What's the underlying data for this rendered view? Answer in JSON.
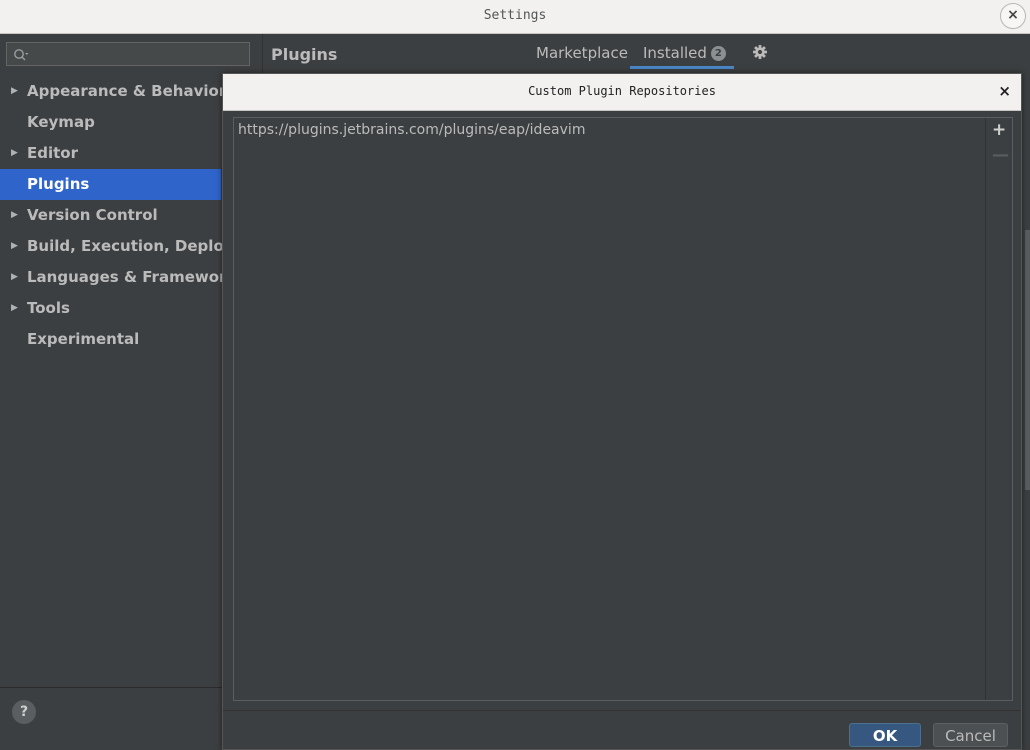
{
  "window": {
    "title": "Settings",
    "close_label": "×"
  },
  "sidebar": {
    "search_placeholder": "",
    "items": [
      {
        "label": "Appearance & Behavior",
        "expandable": true
      },
      {
        "label": "Keymap",
        "expandable": false
      },
      {
        "label": "Editor",
        "expandable": true
      },
      {
        "label": "Plugins",
        "expandable": false,
        "selected": true
      },
      {
        "label": "Version Control",
        "expandable": true
      },
      {
        "label": "Build, Execution, Deployment",
        "expandable": true
      },
      {
        "label": "Languages & Frameworks",
        "expandable": true
      },
      {
        "label": "Tools",
        "expandable": true
      },
      {
        "label": "Experimental",
        "expandable": false
      }
    ],
    "expand_arrow": "▶",
    "help_label": "?"
  },
  "main": {
    "title": "Plugins",
    "tabs": [
      {
        "label": "Marketplace"
      },
      {
        "label": "Installed",
        "badge": "2",
        "active": true
      }
    ]
  },
  "dialog": {
    "title": "Custom Plugin Repositories",
    "close_label": "×",
    "repositories": [
      "https://plugins.jetbrains.com/plugins/eap/ideavim"
    ],
    "add_label": "+",
    "remove_label": "—",
    "ok_label": "OK",
    "cancel_label": "Cancel"
  },
  "colors": {
    "background": "#3c3f41",
    "selection": "#2f65ca",
    "accent": "#4a88c7",
    "ok_button": "#365880"
  }
}
